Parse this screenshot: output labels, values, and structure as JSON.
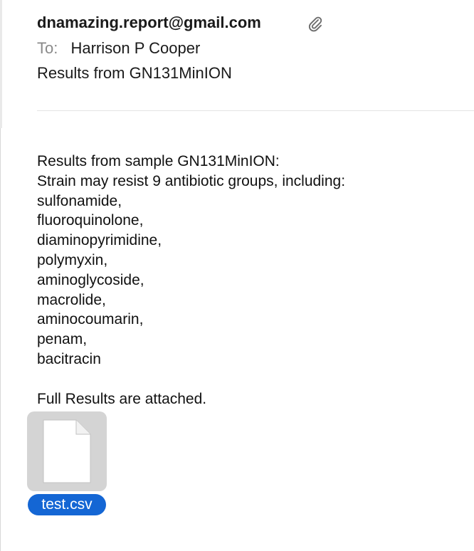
{
  "message": {
    "from": "dnamazing.report@gmail.com",
    "to_label": "To:",
    "to_name": "Harrison P Cooper",
    "subject": "Results from GN131MinION",
    "has_attachment_icon": "paperclip-icon"
  },
  "body": {
    "lines": [
      "Results from sample GN131MinION:",
      "Strain may resist 9 antibiotic groups, including:",
      "sulfonamide,",
      "fluoroquinolone,",
      "diaminopyrimidine,",
      "polymyxin,",
      "aminoglycoside,",
      "macrolide,",
      "aminocoumarin,",
      "penam,",
      "bacitracin"
    ],
    "footer": "Full Results are attached."
  },
  "attachment": {
    "filename": "test.csv",
    "icon": "document-icon",
    "label_color": "#1466d4",
    "tile_color": "#d4d4d4"
  }
}
